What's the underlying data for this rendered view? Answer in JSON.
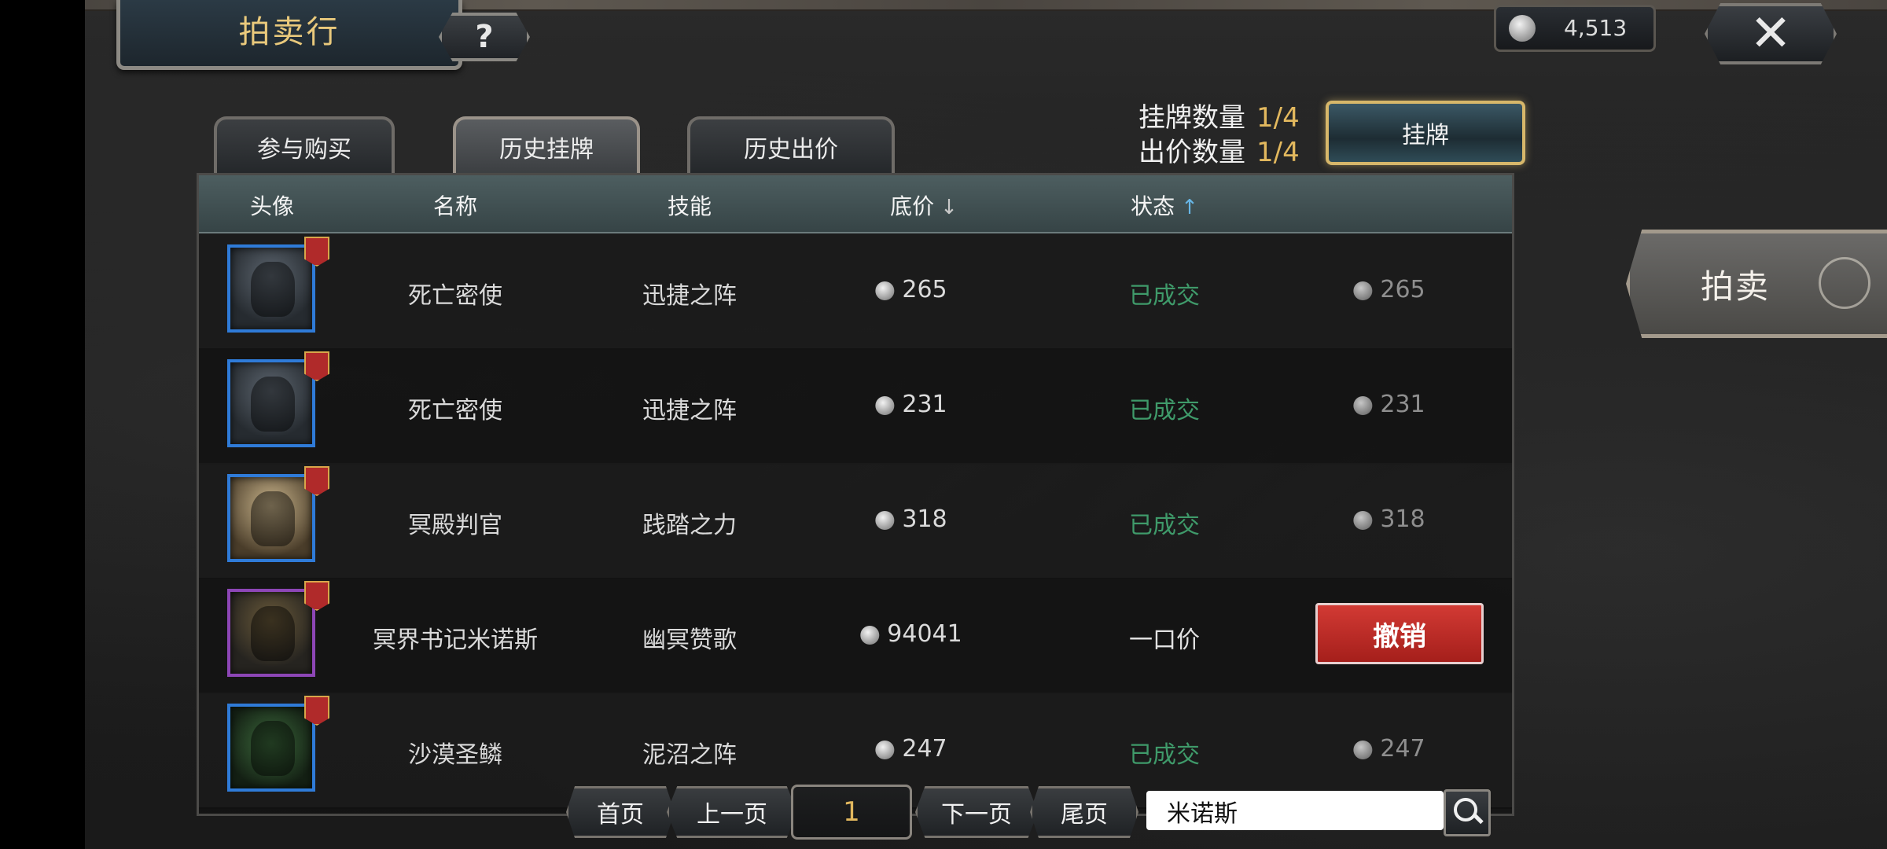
{
  "header": {
    "title": "拍卖行",
    "help_label": "?",
    "currency_value": "4,513",
    "close_label": "✕"
  },
  "tabs": [
    {
      "label": "参与购买"
    },
    {
      "label": "历史挂牌"
    },
    {
      "label": "历史出价"
    }
  ],
  "counts": {
    "listing_label": "挂牌数量",
    "listing_value": "1/4",
    "bid_label": "出价数量",
    "bid_value": "1/4"
  },
  "list_button_label": "挂牌",
  "side_button_label": "拍卖",
  "table": {
    "headers": {
      "avatar": "头像",
      "name": "名称",
      "skill": "技能",
      "price": "底价",
      "status": "状态"
    },
    "rows": [
      {
        "name": "死亡密使",
        "skill": "迅捷之阵",
        "price": "265",
        "status": "已成交",
        "final": "265"
      },
      {
        "name": "死亡密使",
        "skill": "迅捷之阵",
        "price": "231",
        "status": "已成交",
        "final": "231"
      },
      {
        "name": "冥殿判官",
        "skill": "践踏之力",
        "price": "318",
        "status": "已成交",
        "final": "318"
      },
      {
        "name": "冥界书记米诺斯",
        "skill": "幽冥赞歌",
        "price": "94041",
        "status": "一口价",
        "action": "撤销"
      },
      {
        "name": "沙漠圣鳞",
        "skill": "泥沼之阵",
        "price": "247",
        "status": "已成交",
        "final": "247"
      }
    ]
  },
  "pager": {
    "first": "首页",
    "prev": "上一页",
    "page": "1",
    "next": "下一页",
    "last": "尾页"
  },
  "search": {
    "value": "米诺斯"
  },
  "colors": {
    "accent_gold": "#e2b85e",
    "sold_green": "#3f9a6a",
    "cancel_red": "#c62d28"
  }
}
